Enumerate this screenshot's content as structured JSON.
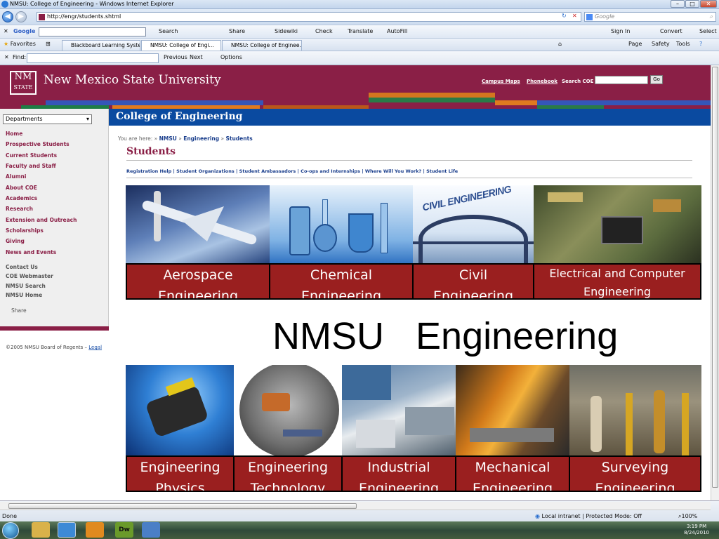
{
  "window": {
    "title": "NMSU: College of Engineering - Windows Internet Explorer"
  },
  "address_bar": {
    "url": "http://engr/students.shtml",
    "search_placeholder": "Google"
  },
  "google_toolbar": {
    "brand": "Google",
    "items": [
      "Search",
      "Share",
      "Sidewiki",
      "Check",
      "Translate",
      "AutoFill"
    ],
    "sign_in": "Sign In",
    "convert": "Convert",
    "select": "Select"
  },
  "tabs": {
    "favorites": "Favorites",
    "items": [
      "Blackboard Learning System",
      "NMSU: College of Engi...",
      "NMSU: College of Enginee..."
    ],
    "right_tools": [
      "Page",
      "Safety",
      "Tools"
    ]
  },
  "find_bar": {
    "label": "Find:",
    "previous": "Previous",
    "next": "Next",
    "options": "Options"
  },
  "site": {
    "logo_line1": "NM",
    "logo_line2": "STATE",
    "university": "New Mexico State University",
    "top_links": [
      "Campus Maps",
      "Phonebook"
    ],
    "search_label": "Search COE",
    "go": "Go",
    "department_select": "Departments",
    "college": "College of Engineering",
    "breadcrumb_prefix": "You are here:",
    "breadcrumb": [
      "NMSU",
      "Engineering",
      "Students"
    ],
    "page_title": "Students",
    "subnav": "Registration Help | Student Organizations | Student Ambassadors | Co-ops and Internships | Where Will You Work? | Student Life",
    "nav": [
      "Home",
      "Prospective Students",
      "Current Students",
      "Faculty and Staff",
      "Alumni",
      "About COE",
      "Academics",
      "Research",
      "Extension and Outreach",
      "Scholarships",
      "Giving",
      "News and Events"
    ],
    "nav_secondary": [
      "Contact Us",
      "COE Webmaster",
      "NMSU Search",
      "NMSU Home"
    ],
    "share": "Share",
    "copyright": "©2005 NMSU Board of Regents – ",
    "legal": "Legal"
  },
  "slide": {
    "title_left": "NMSU",
    "title_right": "Engineering",
    "civil_banner": "CIVIL ENGINEERING",
    "top_row": [
      {
        "line1": "Aerospace",
        "line2": "Engineering"
      },
      {
        "line1": "Chemical",
        "line2": "Engineering"
      },
      {
        "line1": "Civil",
        "line2": "Engineering"
      },
      {
        "line1": "Electrical and Computer",
        "line2": "Engineering"
      }
    ],
    "bottom_row": [
      {
        "line1": "Engineering",
        "line2": "Physics"
      },
      {
        "line1": "Engineering",
        "line2": "Technology"
      },
      {
        "line1": "Industrial",
        "line2": "Engineering"
      },
      {
        "line1": "Mechanical",
        "line2": "Engineering"
      },
      {
        "line1": "Surveying",
        "line2": "Engineering"
      }
    ]
  },
  "status_bar": {
    "left": "Done",
    "zone": "Local intranet | Protected Mode: Off",
    "zoom": "100%"
  },
  "taskbar": {
    "time": "3:19 PM",
    "date": "8/24/2010",
    "dw": "Dw"
  },
  "colors": {
    "maroon": "#8a1f46",
    "label_red": "#9a1f1f",
    "coe_blue": "#0a4aa0"
  }
}
